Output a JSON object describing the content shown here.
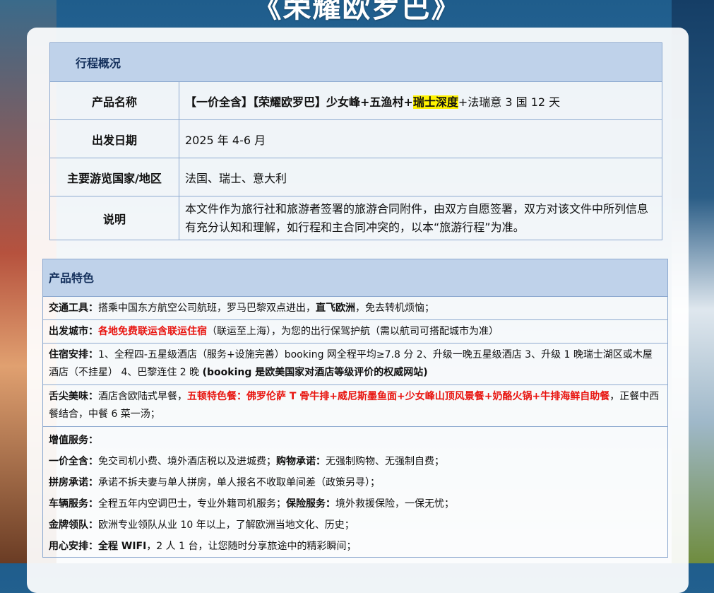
{
  "banner_title": "《荣耀欧罗巴》",
  "overview": {
    "heading": "行程概况",
    "product_label": "产品名称",
    "product_name_a": "【一价全含】【荣耀欧罗巴】少女峰+五渔村+",
    "product_name_highlight": "瑞士深度",
    "product_name_b": "+法瑞意 3 国 12 天",
    "date_label": "出发日期",
    "date_value": "2025 年 4-6 月",
    "countries_label": "主要游览国家/地区",
    "countries_value": "法国、瑞士、意大利",
    "notes_label": "说明",
    "notes_value": "本文件作为旅行社和旅游者签署的旅游合同附件，由双方自愿签署，双方对该文件中所列信息有充分认知和理解，如行程和主合同冲突的，以本“旅游行程”为准。"
  },
  "features": {
    "heading": "产品特色",
    "transport_label": "交通工具：",
    "transport_a": "搭乘中国东方航空公司航班，罗马巴黎双点进出，",
    "transport_bold": "直飞欧洲",
    "transport_b": "，免去转机烦恼；",
    "departure_label": "出发城市：",
    "departure_red": "各地免费联运含联运住宿",
    "departure_b": "（联运至上海），为您的出行保驾护航（需以航司可搭配城市为准）",
    "hotel_label": "住宿安排：",
    "hotel_a": "1、全程四-五星级酒店（服务+设施完善）booking 网全程平均≥7.8 分 2、升级一晚五星级酒店 3、升级 1 晚瑞士湖区或木屋酒店（不挂星） 4、巴黎连住 2 晚 ",
    "hotel_bold": "(booking 是欧美国家对酒店等级评价的权威网站)",
    "food_label": "舌尖美味：",
    "food_a": "酒店含欧陆式早餐，",
    "food_red": "五顿特色餐：佛罗伦萨 T 骨牛排+威尼斯墨鱼面+少女峰山顶风景餐+奶酪火锅+牛排海鲜自助餐",
    "food_b": "，正餐中西餐结合，中餐 6 菜一汤；",
    "value_label": "增值服务：",
    "allin_label": "一价全含：",
    "allin_text": "免交司机小费、境外酒店税以及进城费；",
    "shop_label": "购物承诺：",
    "shop_text": "无强制购物、无强制自费；",
    "room_label": "拼房承诺：",
    "room_text": "承诺不拆夫妻与单人拼房，单人报名不收取单间差（政策另寻）；",
    "vehicle_label": "车辆服务：",
    "vehicle_text": "全程五年内空调巴士，专业外籍司机服务；",
    "insurance_label": "保险服务：",
    "insurance_text": "境外救援保险，一保无忧；",
    "leader_label": "金牌领队：",
    "leader_text": "欧洲专业领队从业 10 年以上，了解欧洲当地文化、历史；",
    "care_label": "用心安排：",
    "care_bold": "全程 WIFI",
    "care_text": "，2 人 1 台，让您随时分享旅途中的精彩瞬间；"
  }
}
